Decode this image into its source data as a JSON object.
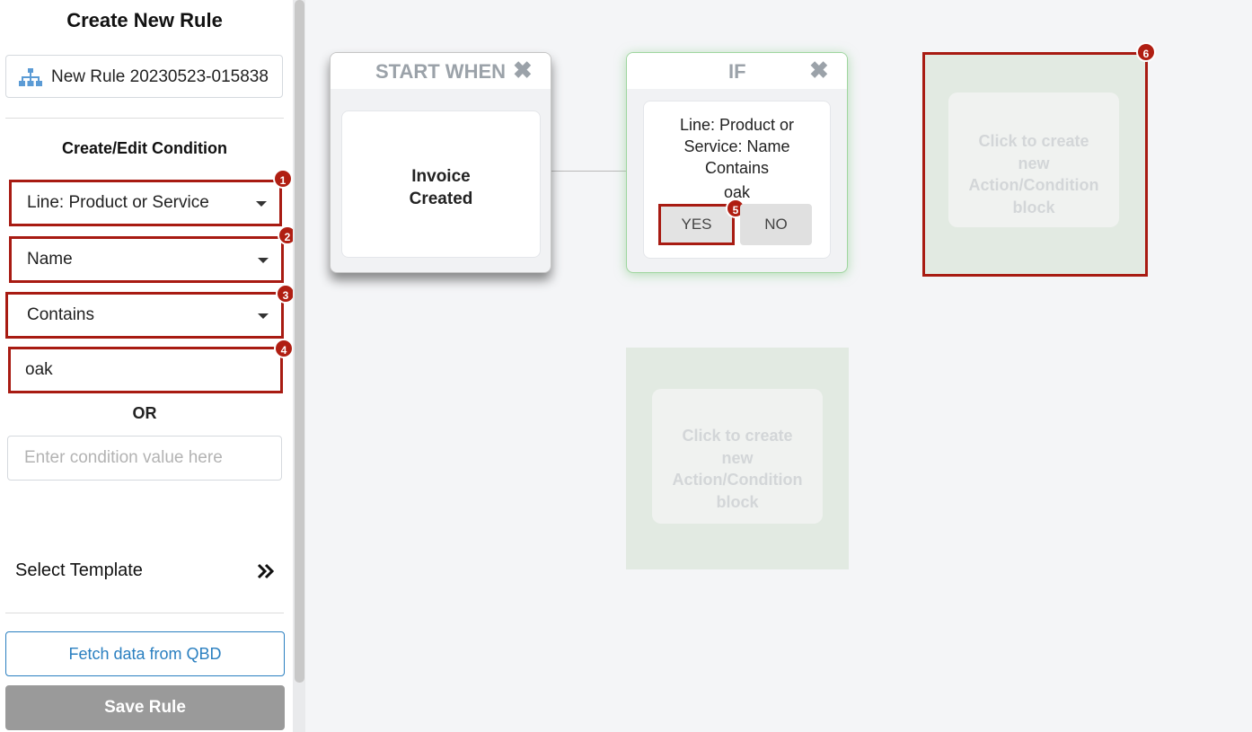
{
  "sidebar": {
    "title": "Create New Rule",
    "rule_name_value": "New Rule 20230523-015838",
    "section_title": "Create/Edit Condition",
    "field_dropdown": "Line: Product or Service",
    "subfield_dropdown": "Name",
    "operator_dropdown": "Contains",
    "value_input": "oak",
    "or_label": "OR",
    "condition_placeholder": "Enter condition value here",
    "select_template_label": "Select Template",
    "fetch_label": "Fetch data from QBD",
    "save_label": "Save Rule"
  },
  "badges": [
    "1",
    "2",
    "3",
    "4",
    "5",
    "6"
  ],
  "canvas": {
    "start_card": {
      "header": "START WHEN",
      "trigger_line1": "Invoice",
      "trigger_line2": "Created"
    },
    "if_card": {
      "header": "IF",
      "line1": "Line: Product or",
      "line2": "Service: Name",
      "line3": "Contains",
      "line4": "oak",
      "yes_label": "YES",
      "no_label": "NO"
    },
    "empty_block": {
      "line1": "Click to create",
      "line2": "new",
      "line3": "Action/Condition",
      "line4": "block"
    }
  },
  "colors": {
    "highlight_red": "#a81b12",
    "link_blue": "#2a7fc0",
    "save_gray": "#9a9a9a",
    "if_glow_green": "#9fd69f"
  },
  "icons": {
    "rule_name": "hierarchy-icon",
    "close": "close-x-icon",
    "template": "double-chevron-right-icon"
  }
}
